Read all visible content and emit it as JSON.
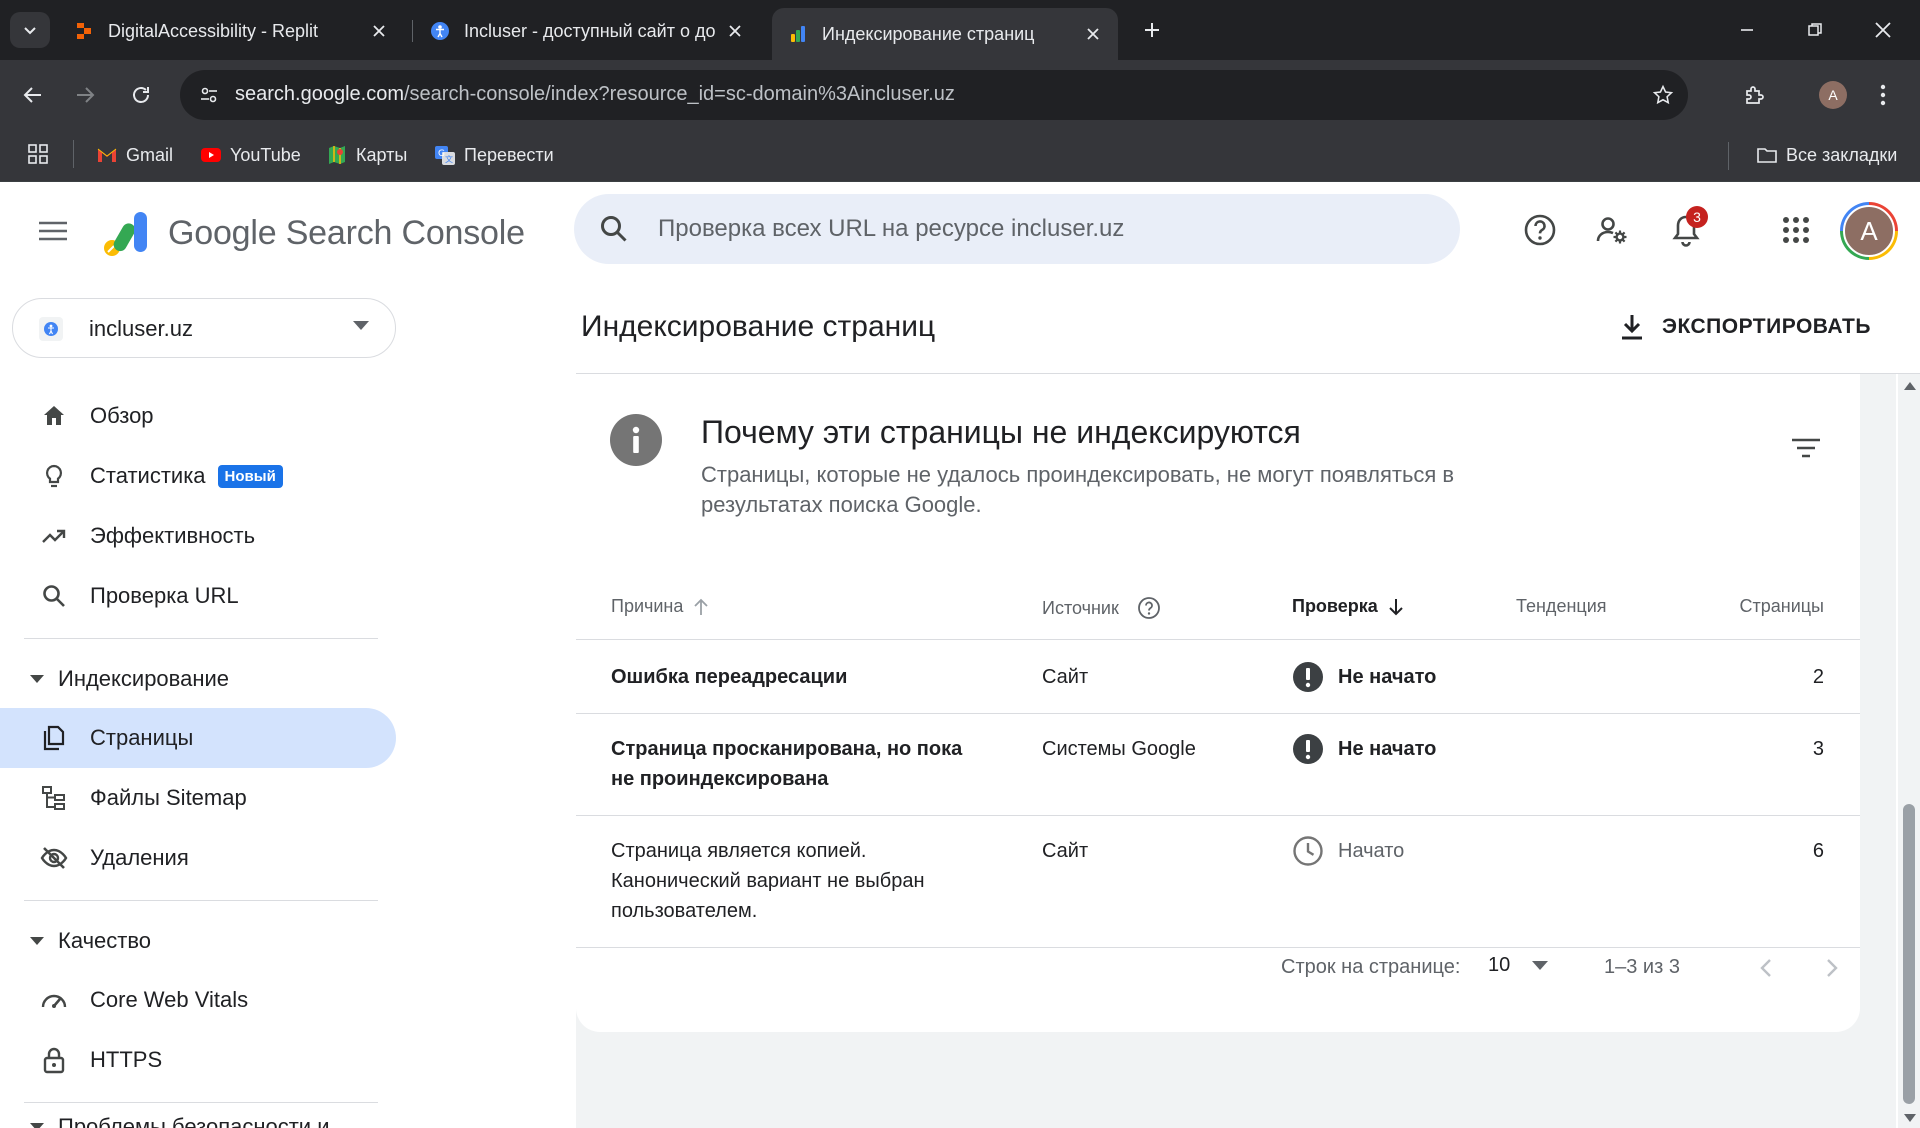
{
  "browser": {
    "tabs": [
      {
        "title": "DigitalAccessibility - Replit"
      },
      {
        "title": "Incluser - доступный сайт о до"
      },
      {
        "title": "Индексирование страниц"
      }
    ],
    "url_host": "search.google.com",
    "url_path": "/search-console/index?resource_id=sc-domain%3Aincluser.uz",
    "profile_initial": "A",
    "bookmarks": [
      {
        "label": "Gmail"
      },
      {
        "label": "YouTube"
      },
      {
        "label": "Карты"
      },
      {
        "label": "Перевести"
      }
    ],
    "all_bookmarks": "Все закладки"
  },
  "header": {
    "wordmark_google": "Google",
    "wordmark_product": "Search Console",
    "search_placeholder": "Проверка всех URL на ресурсе incluser.uz",
    "notification_count": "3",
    "avatar_initial": "A"
  },
  "sidebar": {
    "property": "incluser.uz",
    "items": {
      "overview": "Обзор",
      "statistics": "Статистика",
      "statistics_badge": "Новый",
      "performance": "Эффективность",
      "url_inspection": "Проверка URL",
      "pages": "Страницы",
      "sitemaps": "Файлы Sitemap",
      "removals": "Удаления",
      "cwv": "Core Web Vitals",
      "https": "HTTPS"
    },
    "sections": {
      "indexing": "Индексирование",
      "quality": "Качество",
      "security": "Проблемы безопасности и"
    }
  },
  "main": {
    "page_title": "Индексирование страниц",
    "export_label": "ЭКСПОРТИРОВАТЬ",
    "card": {
      "title": "Почему эти страницы не индексируются",
      "subtitle": "Страницы, которые не удалось проиндексировать, не могут появляться в результатах поиска Google.",
      "columns": {
        "reason": "Причина",
        "source": "Источник",
        "validation": "Проверка",
        "trend": "Тенденция",
        "pages": "Страницы"
      },
      "rows": [
        {
          "reason": "Ошибка переадресации",
          "source": "Сайт",
          "status": "Не начато",
          "pages": "2"
        },
        {
          "reason": "Страница просканирована, но пока не проиндексирована",
          "source": "Системы Google",
          "status": "Не начато",
          "pages": "3"
        },
        {
          "reason": "Страница является копией. Канонический вариант не выбран пользователем.",
          "source": "Сайт",
          "status": "Начато",
          "pages": "6"
        }
      ],
      "pager": {
        "rows_per_page_label": "Строк на странице:",
        "rows_per_page_value": "10",
        "range": "1–3 из 3"
      }
    }
  },
  "colors": {
    "accent": "#1a73e8",
    "active_nav": "#d3e3fd",
    "status_not_started": "#3c4043",
    "status_started": "#757575"
  }
}
